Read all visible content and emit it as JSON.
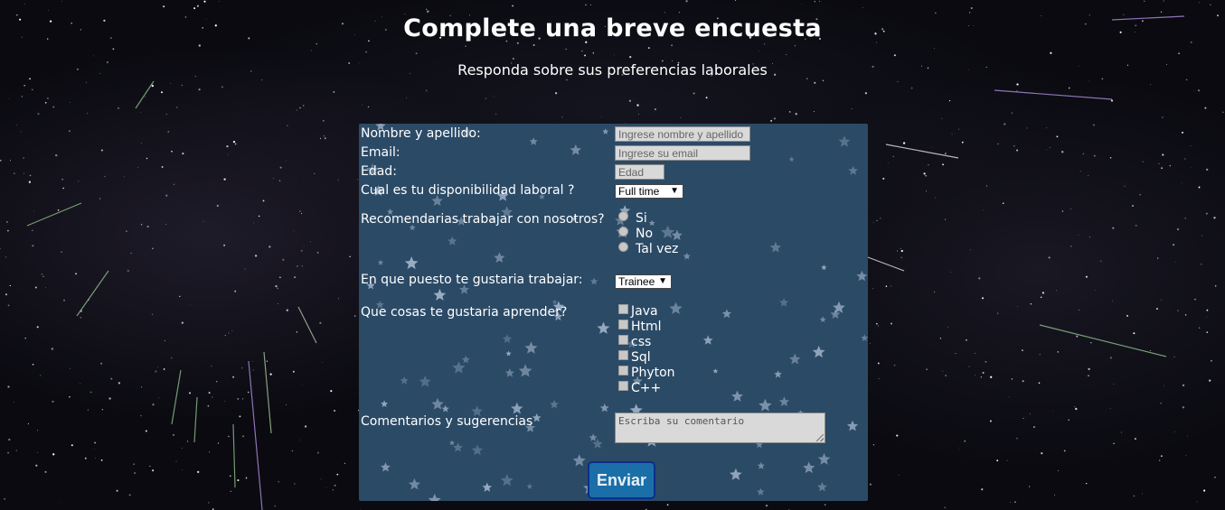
{
  "header": {
    "title": "Complete una breve encuesta",
    "subtitle": "Responda sobre sus preferencias laborales"
  },
  "form": {
    "name": {
      "label": "Nombre y apellido:",
      "placeholder": "Ingrese nombre y apellido",
      "value": ""
    },
    "email": {
      "label": "Email:",
      "placeholder": "Ingrese su email",
      "value": ""
    },
    "age": {
      "label": "Edad:",
      "placeholder": "Edad",
      "value": ""
    },
    "availability": {
      "label": "Cual es tu disponibilidad laboral ?",
      "selected": "Full time"
    },
    "recommend": {
      "label": "Recomendarias trabajar con nosotros?",
      "options": [
        "Si",
        "No",
        "Tal vez"
      ]
    },
    "position": {
      "label": "En que puesto te gustaria trabajar:",
      "selected": "Trainee"
    },
    "learn": {
      "label": "Que cosas te gustaria aprender?",
      "options": [
        "Java",
        "Html",
        "css",
        "Sql",
        "Phyton",
        "C++"
      ]
    },
    "comments": {
      "label": "Comentarios y sugerencias",
      "placeholder": "Escriba su comentario",
      "value": ""
    },
    "submit_label": "Enviar"
  },
  "icons": {
    "select_arrow": "caret-down-icon",
    "background": "starry-sky",
    "panel_pattern": "stars-pattern"
  },
  "colors": {
    "page_background": "#0a0a10",
    "panel_background": "#2b4a66",
    "submit_background": "#1b6fa8",
    "submit_border": "#0b2e8a",
    "field_background": "#d9d9d9"
  }
}
